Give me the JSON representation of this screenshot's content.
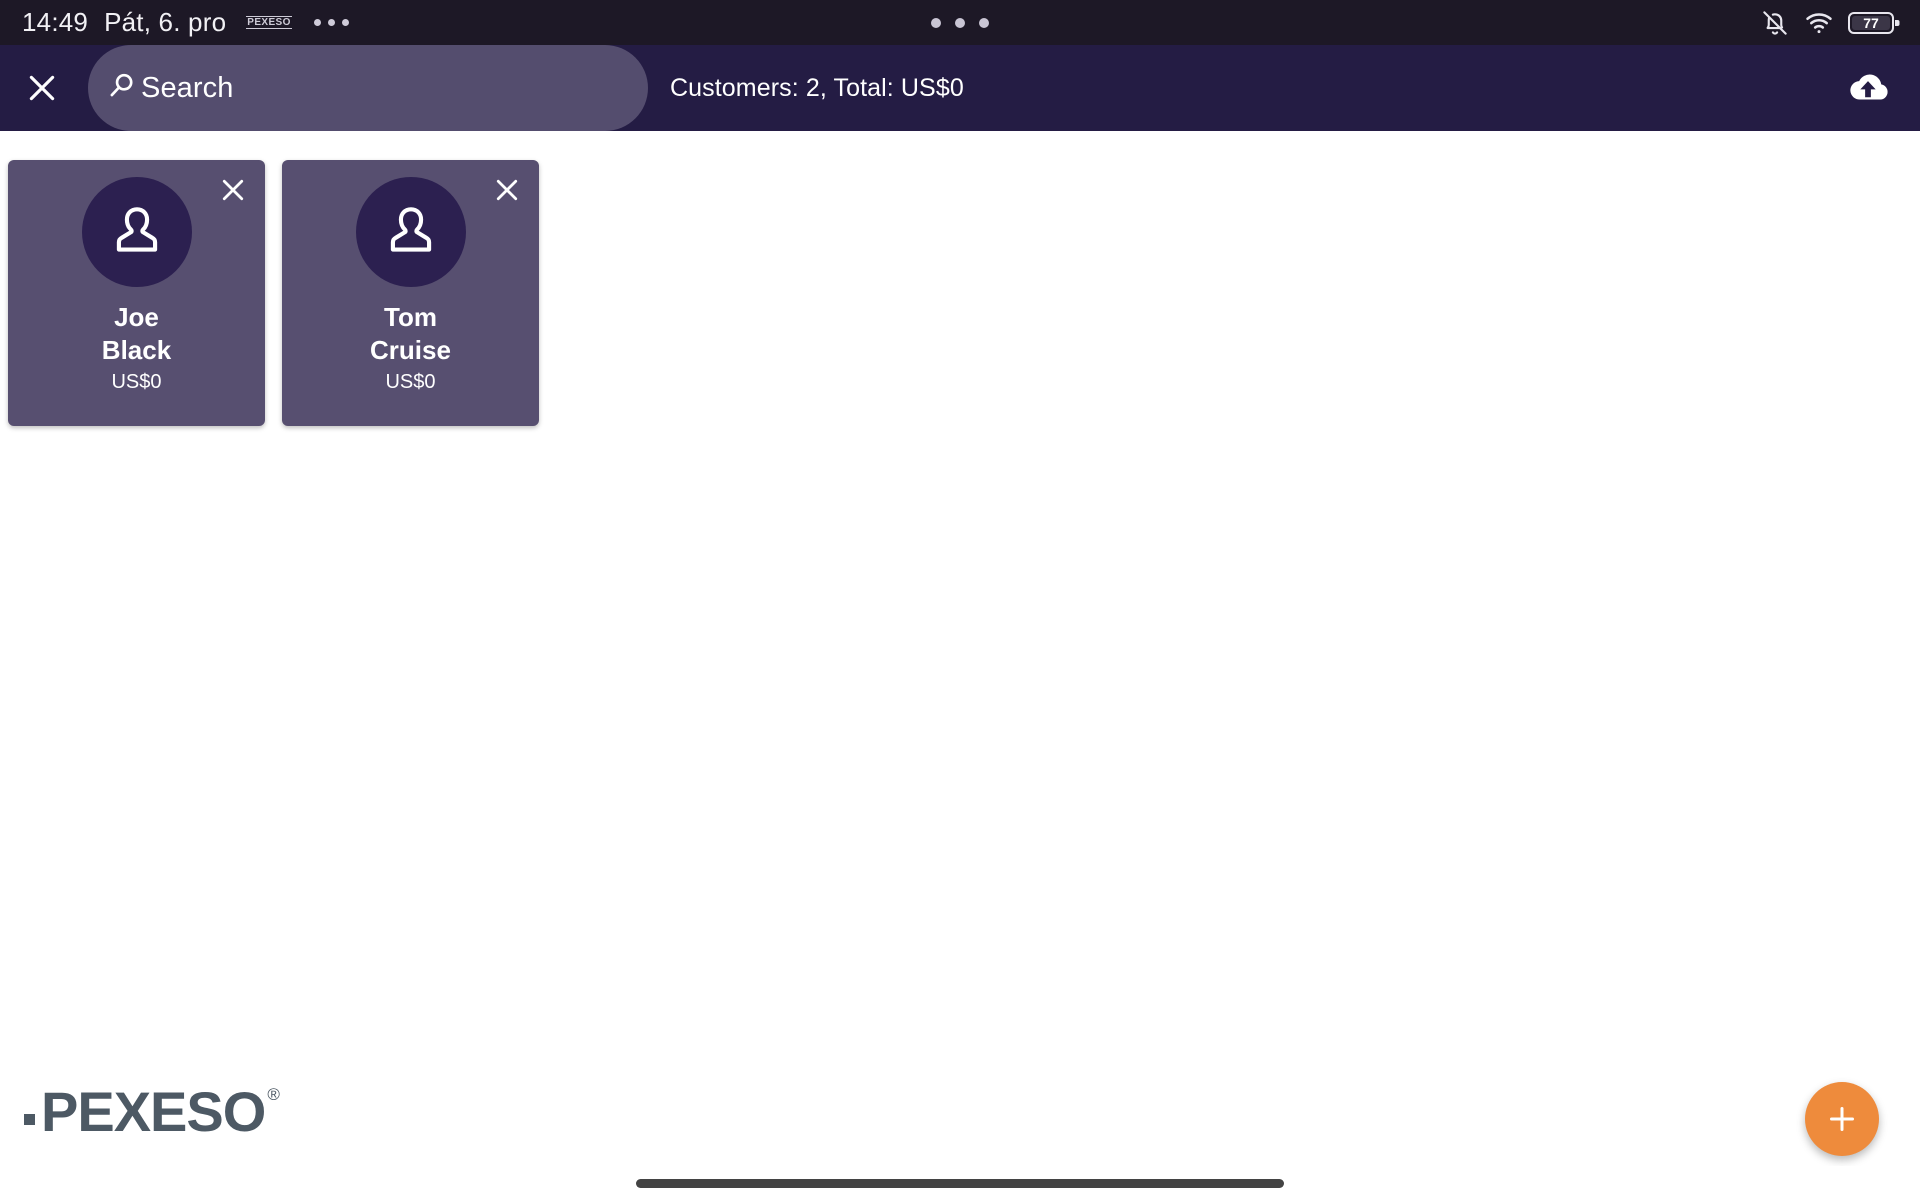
{
  "status_bar": {
    "clock": "14:49",
    "date": "Pát, 6. pro",
    "app_notification_label": "PEXESO",
    "icons": {
      "notifications_muted": "bell-slash-icon",
      "wifi": "wifi-icon",
      "battery": "battery-icon"
    },
    "battery_percent": "77",
    "camera_indicator": "three-dots-indicator"
  },
  "header": {
    "close_label": "close-icon",
    "search": {
      "placeholder": "Search",
      "value": "",
      "icon": "search-icon"
    },
    "summary": "Customers: 2, Total: US$0",
    "upload_label": "cloud-upload-icon"
  },
  "customers": [
    {
      "name": "Joe\nBlack",
      "amount": "US$0",
      "avatar": "person-avatar-icon",
      "remove_label": "close-icon"
    },
    {
      "name": "Tom\nCruise",
      "amount": "US$0",
      "avatar": "person-avatar-icon",
      "remove_label": "close-icon"
    }
  ],
  "brand": {
    "word": "PEXESO",
    "registered": "®"
  },
  "fab": {
    "label": "add-customer-button",
    "icon": "plus-icon"
  },
  "colors": {
    "status_bar_bg": "#1d1826",
    "header_bg": "#241c44",
    "search_pill_bg": "#544d6e",
    "card_bg": "#574f70",
    "avatar_bg": "#2c2050",
    "fab_bg": "#ee8b3c",
    "brand_gray": "#4d5964",
    "content_bg": "#ffffff"
  }
}
